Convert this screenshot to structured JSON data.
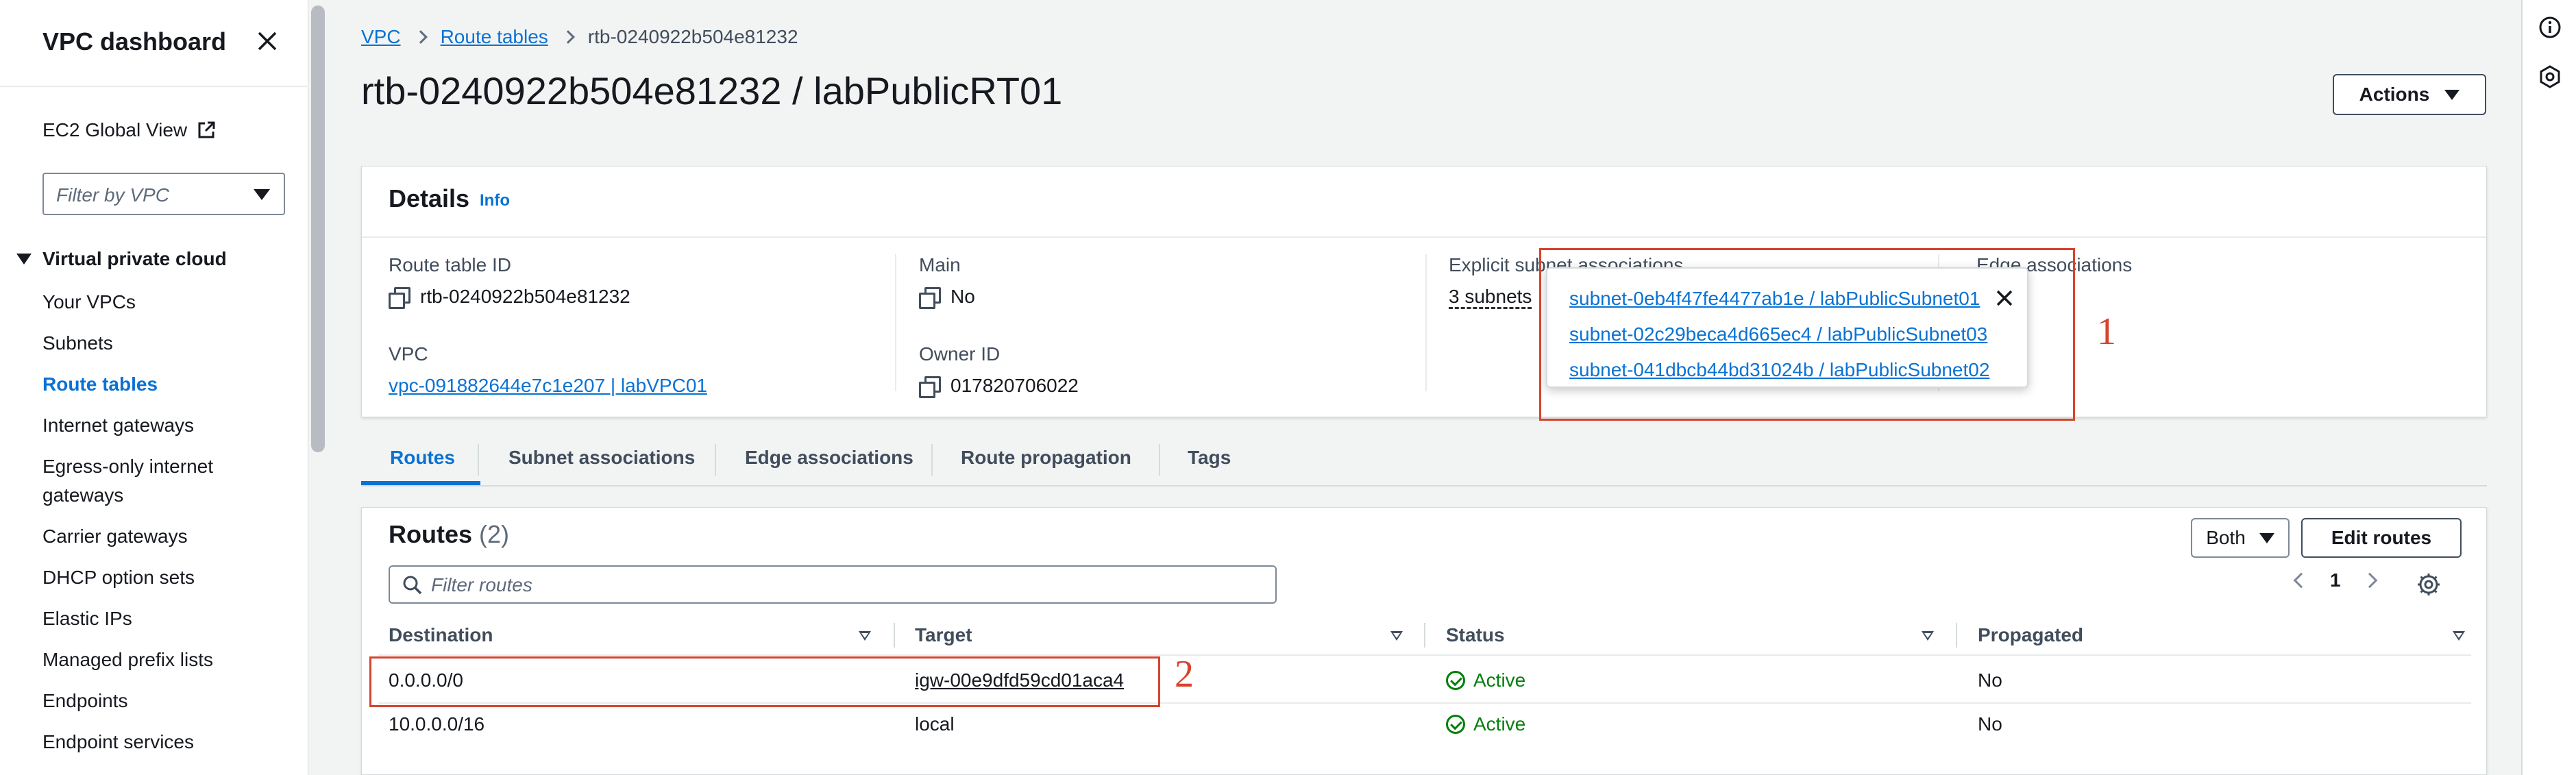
{
  "sidebar": {
    "title": "VPC dashboard",
    "ec2_global_view": "EC2 Global View",
    "filter_placeholder": "Filter by VPC",
    "section": "Virtual private cloud",
    "items": [
      {
        "label": "Your VPCs"
      },
      {
        "label": "Subnets"
      },
      {
        "label": "Route tables"
      },
      {
        "label": "Internet gateways"
      },
      {
        "label": "Egress-only internet gateways"
      },
      {
        "label": "Carrier gateways"
      },
      {
        "label": "DHCP option sets"
      },
      {
        "label": "Elastic IPs"
      },
      {
        "label": "Managed prefix lists"
      },
      {
        "label": "Endpoints"
      },
      {
        "label": "Endpoint services"
      }
    ],
    "active_item": "Route tables"
  },
  "breadcrumb": {
    "items": [
      "VPC",
      "Route tables"
    ],
    "current": "rtb-0240922b504e81232"
  },
  "page_title": "rtb-0240922b504e81232 / labPublicRT01",
  "actions_label": "Actions",
  "details": {
    "title": "Details",
    "info": "Info",
    "route_table_id_label": "Route table ID",
    "route_table_id": "rtb-0240922b504e81232",
    "vpc_label": "VPC",
    "vpc": "vpc-091882644e7c1e207 | labVPC01",
    "main_label": "Main",
    "main": "No",
    "owner_label": "Owner ID",
    "owner": "017820706022",
    "explicit_label": "Explicit subnet associations",
    "explicit_value": "3 subnets",
    "edge_label": "Edge associations"
  },
  "popover": {
    "links": [
      "subnet-0eb4f47fe4477ab1e / labPublicSubnet01",
      "subnet-02c29beca4d665ec4 / labPublicSubnet03",
      "subnet-041dbcb44bd31024b / labPublicSubnet02"
    ]
  },
  "annotations": [
    "1",
    "2"
  ],
  "tabs": [
    "Routes",
    "Subnet associations",
    "Edge associations",
    "Route propagation",
    "Tags"
  ],
  "routes": {
    "title": "Routes",
    "count": "(2)",
    "both_label": "Both",
    "edit_label": "Edit routes",
    "filter_placeholder": "Filter routes",
    "page": "1",
    "columns": [
      "Destination",
      "Target",
      "Status",
      "Propagated"
    ],
    "rows": [
      {
        "destination": "0.0.0.0/0",
        "target": "igw-00e9dfd59cd01aca4",
        "status": "Active",
        "propagated": "No"
      },
      {
        "destination": "10.0.0.0/16",
        "target": "local",
        "status": "Active",
        "propagated": "No"
      }
    ]
  },
  "colors": {
    "link": "#0972d3",
    "status_ok": "#037f0c",
    "annotation": "#d5442c"
  }
}
